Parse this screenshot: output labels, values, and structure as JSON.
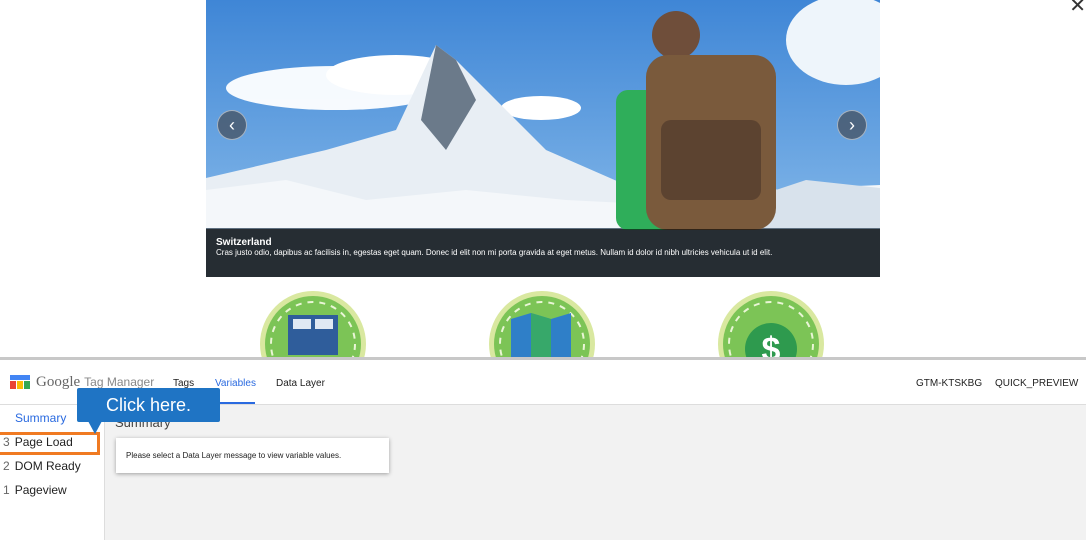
{
  "carousel": {
    "prev_icon": "chevron-left",
    "next_icon": "chevron-right",
    "caption_title": "Switzerland",
    "caption_text": "Cras justo odio, dapibus ac facilisis in, egestas eget quam. Donec id elit non mi porta gravida at eget metus. Nullam id dolor id nibh ultricies vehicula ut id elit."
  },
  "close_icon": "close-icon",
  "gtm": {
    "logo_google": "Google",
    "logo_product": "Tag Manager",
    "tabs": [
      "Tags",
      "Variables",
      "Data Layer"
    ],
    "active_tab": "Variables",
    "container_id": "GTM-KTSKBG",
    "environment": "QUICK_PREVIEW",
    "sidebar": {
      "summary": "Summary",
      "items": [
        {
          "num": "3",
          "label": "Page Load"
        },
        {
          "num": "2",
          "label": "DOM Ready"
        },
        {
          "num": "1",
          "label": "Pageview"
        }
      ]
    },
    "main_heading": "Summary",
    "message": "Please select a Data Layer message to view variable values."
  },
  "tooltip": "Click here.",
  "colors": {
    "accent": "#2a6ae0",
    "highlight": "#f07a22",
    "tooltip": "#1f74c4",
    "badge_green": "#7cc456"
  }
}
